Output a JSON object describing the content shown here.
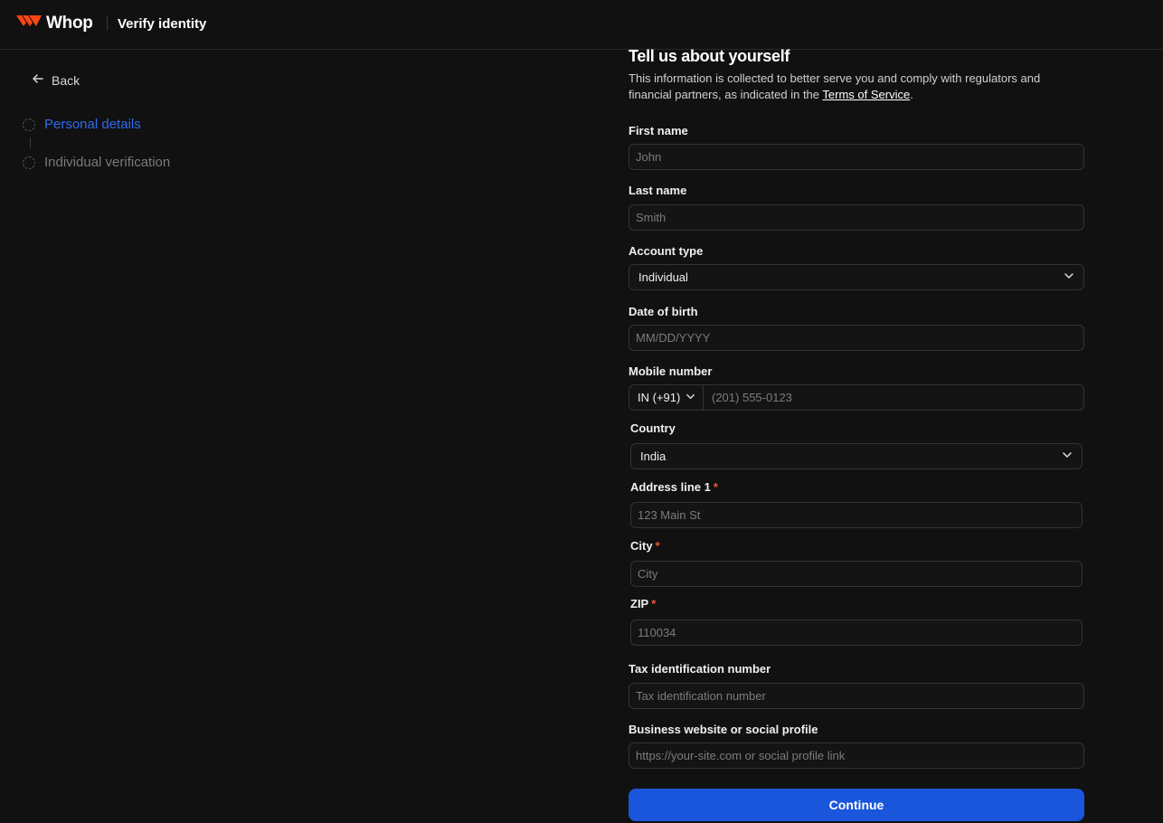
{
  "header": {
    "brand": "Whop",
    "title": "Verify identity"
  },
  "sidebar": {
    "back_label": "Back",
    "steps": [
      {
        "label": "Personal details",
        "active": true
      },
      {
        "label": "Individual verification",
        "active": false
      }
    ]
  },
  "form": {
    "title": "Tell us about yourself",
    "description_prefix": "This information is collected to better serve you and comply with regulators and financial partners, as indicated in the ",
    "tos_link": "Terms of Service",
    "description_suffix": ".",
    "first_name": {
      "label": "First name",
      "placeholder": "John",
      "value": ""
    },
    "last_name": {
      "label": "Last name",
      "placeholder": "Smith",
      "value": ""
    },
    "account_type": {
      "label": "Account type",
      "value": "Individual"
    },
    "dob": {
      "label": "Date of birth",
      "placeholder": "MM/DD/YYYY",
      "value": ""
    },
    "mobile": {
      "label": "Mobile number",
      "country_code": "IN (+91)",
      "placeholder": "(201) 555-0123",
      "value": ""
    },
    "country": {
      "label": "Country",
      "value": "India"
    },
    "address1": {
      "label": "Address line 1",
      "required_mark": "*",
      "placeholder": "123 Main St",
      "value": ""
    },
    "city": {
      "label": "City",
      "required_mark": "*",
      "placeholder": "City",
      "value": ""
    },
    "zip": {
      "label": "ZIP",
      "required_mark": "*",
      "placeholder": "110034",
      "value": ""
    },
    "tax_id": {
      "label": "Tax identification number",
      "placeholder": "Tax identification number",
      "value": ""
    },
    "website": {
      "label": "Business website or social profile",
      "placeholder": "https://your-site.com or social profile link",
      "value": ""
    },
    "continue_label": "Continue"
  },
  "colors": {
    "background": "#111111",
    "accent": "#1a56db",
    "active_step": "#2f6bf0",
    "required": "#f2553b",
    "brand_logo": "#fa4616"
  },
  "icons": {
    "logo": "whop-logo-icon",
    "back": "arrow-left-icon",
    "dropdown": "chevron-down-icon"
  }
}
